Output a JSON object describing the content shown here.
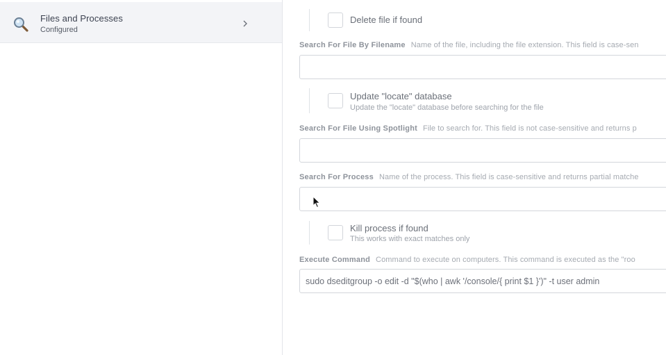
{
  "sidebar": {
    "items": [
      {
        "title": "Files and Processes",
        "subtitle": "Configured",
        "icon": "search-icon",
        "chevron": "chevron-right-icon"
      }
    ]
  },
  "form": {
    "delete_file": {
      "label": "Delete file if found"
    },
    "search_by_filename": {
      "label": "Search For File By Filename",
      "help": "Name of the file, including the file extension. This field is case-sen",
      "value": ""
    },
    "update_locate": {
      "label": "Update \"locate\" database",
      "help": "Update the \"locate\" database before searching for the file"
    },
    "search_spotlight": {
      "label": "Search For File Using Spotlight",
      "help": "File to search for. This field is not case-sensitive and returns p",
      "value": ""
    },
    "search_process": {
      "label": "Search For Process",
      "help": "Name of the process. This field is case-sensitive and returns partial matche",
      "value": ""
    },
    "kill_process": {
      "label": "Kill process if found",
      "help": "This works with exact matches only"
    },
    "execute_command": {
      "label": "Execute Command",
      "help": "Command to execute on computers. This command is executed as the \"roo",
      "value": "sudo dseditgroup -o edit -d \"$(who | awk '/console/{ print $1 }')\" -t user admin"
    }
  },
  "colors": {
    "sidebar_selected_bg": "#f3f4f7",
    "border": "#d3d6db",
    "label": "#8e939b"
  }
}
